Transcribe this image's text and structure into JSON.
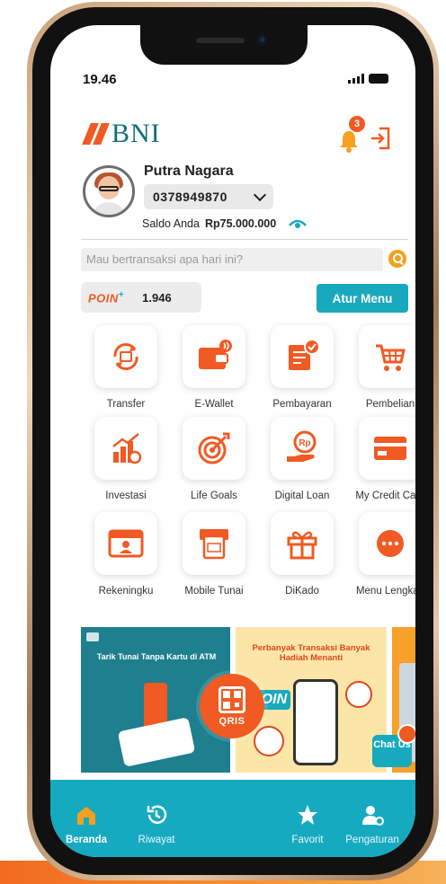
{
  "status_bar": {
    "time": "19.46",
    "signal_icon": "signal-icon",
    "battery_icon": "battery-icon"
  },
  "header": {
    "brand": "BNI",
    "notification_count": "3",
    "colors": {
      "brand_orange": "#f15a22",
      "brand_teal": "#0d6f7a",
      "accent": "#19a9be"
    }
  },
  "profile": {
    "name": "Putra Nagara",
    "account_number": "0378949870",
    "balance_label": "Saldo Anda",
    "balance_value": "Rp75.000.000"
  },
  "search": {
    "placeholder": "Mau bertransaksi apa hari ini?"
  },
  "points": {
    "logo_text": "POIN",
    "logo_plus": "+",
    "value": "1.946"
  },
  "atur_menu_label": "Atur Menu",
  "menu": [
    {
      "label": "Transfer",
      "icon": "transfer-icon"
    },
    {
      "label": "E-Wallet",
      "icon": "e-wallet-icon"
    },
    {
      "label": "Pembayaran",
      "icon": "pembayaran-icon"
    },
    {
      "label": "Pembelian",
      "icon": "pembelian-icon"
    },
    {
      "label": "Investasi",
      "icon": "investasi-icon"
    },
    {
      "label": "Life Goals",
      "icon": "life-goals-icon"
    },
    {
      "label": "Digital Loan",
      "icon": "digital-loan-icon"
    },
    {
      "label": "My Credit Card",
      "icon": "credit-card-icon"
    },
    {
      "label": "Rekeningku",
      "icon": "rekeningku-icon"
    },
    {
      "label": "Mobile Tunai",
      "icon": "mobile-tunai-icon"
    },
    {
      "label": "DiKado",
      "icon": "dikado-icon"
    },
    {
      "label": "Menu Lengkap",
      "icon": "menu-lengkap-icon"
    }
  ],
  "banners": {
    "banner1_title": "Tarik Tunai Tanpa Kartu di ATM",
    "banner2_title": "Perbanyak Transaksi Banyak Hadiah Menanti",
    "banner2_poin": "POIN"
  },
  "chat": {
    "label": "Chat Us"
  },
  "navbar": {
    "beranda": "Beranda",
    "riwayat": "Riwayat",
    "qris": "QRIS",
    "favorit": "Favorit",
    "pengaturan": "Pengaturan"
  }
}
